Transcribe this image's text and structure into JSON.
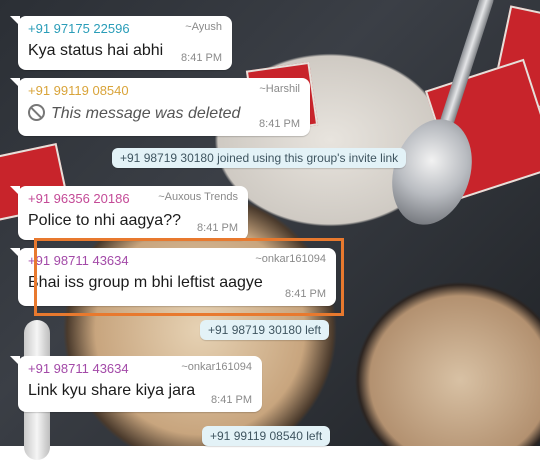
{
  "messages": [
    {
      "sender": "+91 97175 22596",
      "alias": "~Ayush",
      "text": "Kya status hai abhi",
      "time": "8:41 PM",
      "sender_color": "#2a9db8"
    },
    {
      "sender": "+91 99119 08540",
      "alias": "~Harshil",
      "text": "This message was deleted",
      "time": "8:41 PM",
      "sender_color": "#d9a43a"
    },
    {
      "sender": "+91 96356 20186",
      "alias": "~Auxous Trends",
      "text": "Police to nhi aagya??",
      "time": "8:41 PM",
      "sender_color": "#c44a97"
    },
    {
      "sender": "+91 98711 43634",
      "alias": "~onkar161094",
      "text": "Bhai iss group m bhi leftist aagye",
      "time": "8:41 PM",
      "sender_color": "#a34aa8"
    },
    {
      "sender": "+91 98711 43634",
      "alias": "~onkar161094",
      "text": "Link kyu share kiya jara",
      "time": "8:41 PM",
      "sender_color": "#a34aa8"
    }
  ],
  "system": [
    "+91 98719 30180 joined using this group's invite link",
    "+91 98719 30180 left",
    "+91 99119 08540 left"
  ]
}
